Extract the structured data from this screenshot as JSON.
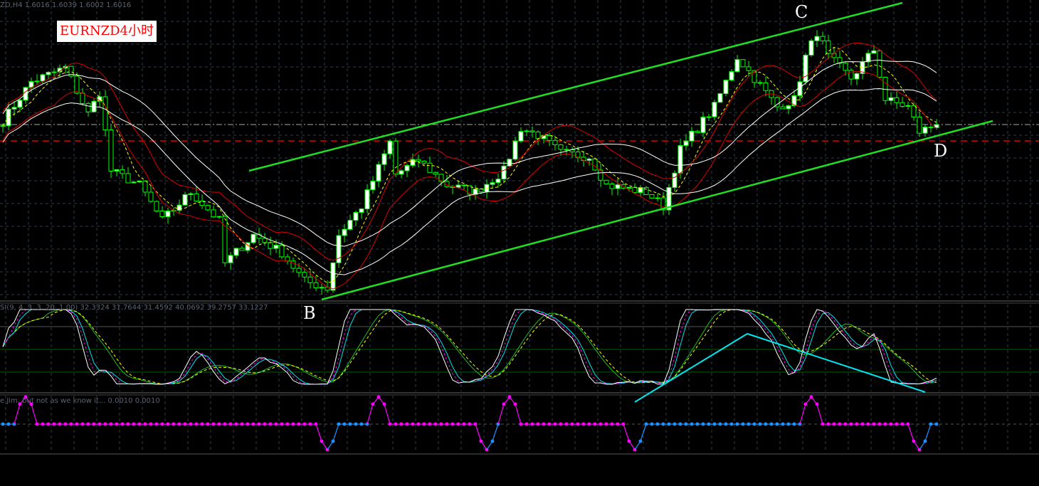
{
  "header": {
    "symbol_ohlc": "ZD,H4  1.6016 1.6039 1.6002 1.6016"
  },
  "title_label": "EURNZD4小时",
  "annotations": {
    "b": "B",
    "c": "C",
    "d": "D"
  },
  "oscillator": {
    "label": "SI(9, 4, 3, 3, 20, 1.00) 32.3324 31.7644 31.4592 40.0692 39.2757 33.1227"
  },
  "signal_panel": {
    "label": "e Jim, but not as we know it...  0.0010 0.0010"
  },
  "colors": {
    "background": "#000000",
    "candle": "#00ff00",
    "bull_body": "#ffffff",
    "trendline": "#22dd22",
    "ma_fast": "#ffff00",
    "envelope_inner": "#dd0000",
    "envelope_outer": "#ffffff",
    "divergence": "#00e5ee",
    "signal_up": "#ff00ff",
    "signal_down": "#1e90ff",
    "level_line": "#dd0000"
  },
  "chart_data": {
    "type": "candlestick",
    "symbol": "EURNZD",
    "timeframe": "H4",
    "last_ohlc": [
      1.6016,
      1.6039,
      1.6002,
      1.6016
    ],
    "grid": true,
    "approx_close_path": [
      [
        0,
        1.6031
      ],
      [
        5,
        1.6196
      ],
      [
        11,
        1.6256
      ],
      [
        15,
        1.6061
      ],
      [
        17,
        1.6151
      ],
      [
        19,
        1.5821
      ],
      [
        24,
        1.5761
      ],
      [
        28,
        1.5611
      ],
      [
        33,
        1.5731
      ],
      [
        38,
        1.5611
      ],
      [
        39,
        1.5431
      ],
      [
        44,
        1.5551
      ],
      [
        49,
        1.5476
      ],
      [
        53,
        1.5356
      ],
      [
        57,
        1.5326
      ],
      [
        59,
        1.5551
      ],
      [
        63,
        1.5671
      ],
      [
        68,
        1.5941
      ],
      [
        69,
        1.5806
      ],
      [
        73,
        1.5866
      ],
      [
        78,
        1.5761
      ],
      [
        83,
        1.5731
      ],
      [
        88,
        1.5821
      ],
      [
        91,
        1.6001
      ],
      [
        94,
        1.5971
      ],
      [
        98,
        1.5896
      ],
      [
        103,
        1.5881
      ],
      [
        106,
        1.5761
      ],
      [
        113,
        1.5731
      ],
      [
        116,
        1.5671
      ],
      [
        119,
        1.5911
      ],
      [
        125,
        1.6091
      ],
      [
        129,
        1.6301
      ],
      [
        133,
        1.6181
      ],
      [
        136,
        1.6091
      ],
      [
        139,
        1.6121
      ],
      [
        141,
        1.6301
      ],
      [
        143,
        1.6406
      ],
      [
        145,
        1.6301
      ],
      [
        149,
        1.6211
      ],
      [
        153,
        1.6331
      ],
      [
        155,
        1.6121
      ],
      [
        159,
        1.6091
      ],
      [
        161,
        1.5986
      ],
      [
        164,
        1.6016
      ]
    ],
    "signal_events": [
      [
        3,
        1
      ],
      [
        4,
        2
      ],
      [
        5,
        1
      ],
      [
        56,
        -1
      ],
      [
        57,
        -2
      ],
      [
        58,
        -1
      ],
      [
        65,
        1
      ],
      [
        66,
        2
      ],
      [
        67,
        1
      ],
      [
        84,
        -1
      ],
      [
        85,
        -2
      ],
      [
        86,
        -1
      ],
      [
        88,
        1
      ],
      [
        89,
        2
      ],
      [
        90,
        1
      ],
      [
        110,
        -1
      ],
      [
        111,
        -2
      ],
      [
        112,
        -1
      ],
      [
        141,
        1
      ],
      [
        142,
        2
      ],
      [
        143,
        1
      ],
      [
        160,
        -1
      ],
      [
        161,
        -2
      ],
      [
        162,
        -1
      ]
    ]
  }
}
